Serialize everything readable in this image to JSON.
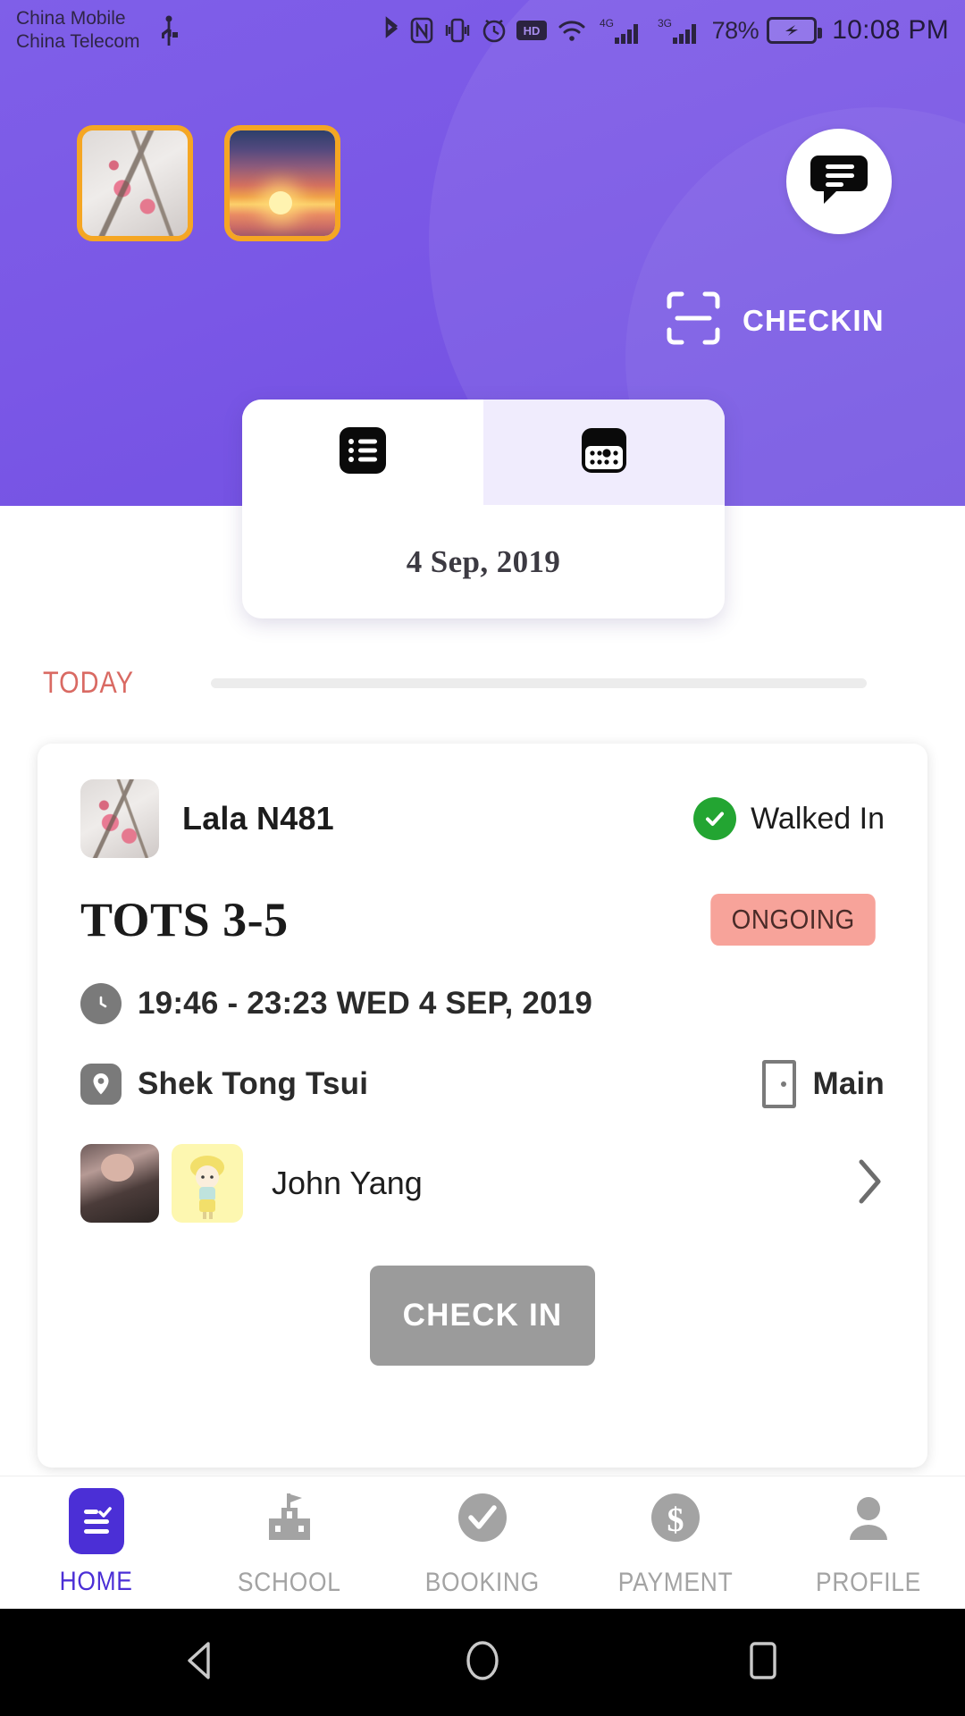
{
  "statusbar": {
    "carrier_line1": "China Mobile",
    "carrier_line2": "China Telecom",
    "icons": [
      "usb-icon",
      "bluetooth-icon",
      "nfc-icon",
      "vibrate-icon",
      "alarm-icon",
      "hd-icon",
      "wifi-icon",
      "signal-4g-icon",
      "signal-3g-icon"
    ],
    "battery_percent": "78%",
    "battery_icon": "battery-charging-icon",
    "time": "10:08 PM"
  },
  "header": {
    "thumbnails": [
      {
        "name": "thumbnail-blossom",
        "alt": "cherry blossom photo"
      },
      {
        "name": "thumbnail-sunset",
        "alt": "sunset over sea photo"
      }
    ],
    "chat_icon": "chat-bubble-icon",
    "checkin": {
      "icon": "scan-checkin-icon",
      "label": "CHECKIN"
    }
  },
  "viewtoggle": {
    "list_icon": "list-view-icon",
    "calendar_icon": "calendar-view-icon",
    "active": "list",
    "date": "4 Sep,  2019"
  },
  "section": {
    "today_label": "TODAY"
  },
  "booking_card": {
    "child_avatar": "child-avatar",
    "child_name": "Lala  N481",
    "status_icon": "check-circle-icon",
    "status_text": "Walked In",
    "course_title": "TOTS 3-5",
    "badge": "ONGOING",
    "time_icon": "clock-icon",
    "time_text": "19:46 - 23:23 WED 4 SEP,  2019",
    "location_icon": "map-pin-icon",
    "location_text": "Shek Tong Tsui",
    "room_icon": "door-icon",
    "room_text": "Main",
    "teacher_photo": "teacher-photo",
    "teacher_avatar": "teacher-cartoon-avatar",
    "teacher_name": "John Yang",
    "chevron_icon": "chevron-right-icon",
    "action_button": "CHECK IN"
  },
  "bottomnav": {
    "items": [
      {
        "label": "HOME",
        "icon": "home-checklist-icon",
        "active": true
      },
      {
        "label": "SCHOOL",
        "icon": "school-building-icon",
        "active": false
      },
      {
        "label": "BOOKING",
        "icon": "check-circle-icon",
        "active": false
      },
      {
        "label": "PAYMENT",
        "icon": "dollar-circle-icon",
        "active": false
      },
      {
        "label": "PROFILE",
        "icon": "person-icon",
        "active": false
      }
    ]
  },
  "androidnav": {
    "back_icon": "back-triangle-icon",
    "home_icon": "home-circle-icon",
    "recents_icon": "recents-square-icon"
  },
  "colors": {
    "header_purple": "#7a57e6",
    "accent_indigo": "#4b2fd6",
    "badge_pink": "#f7a39a",
    "today_red": "#d96a63",
    "status_green": "#23a532",
    "button_gray": "#9b9b9b",
    "thumb_border_orange": "#F5A623"
  }
}
